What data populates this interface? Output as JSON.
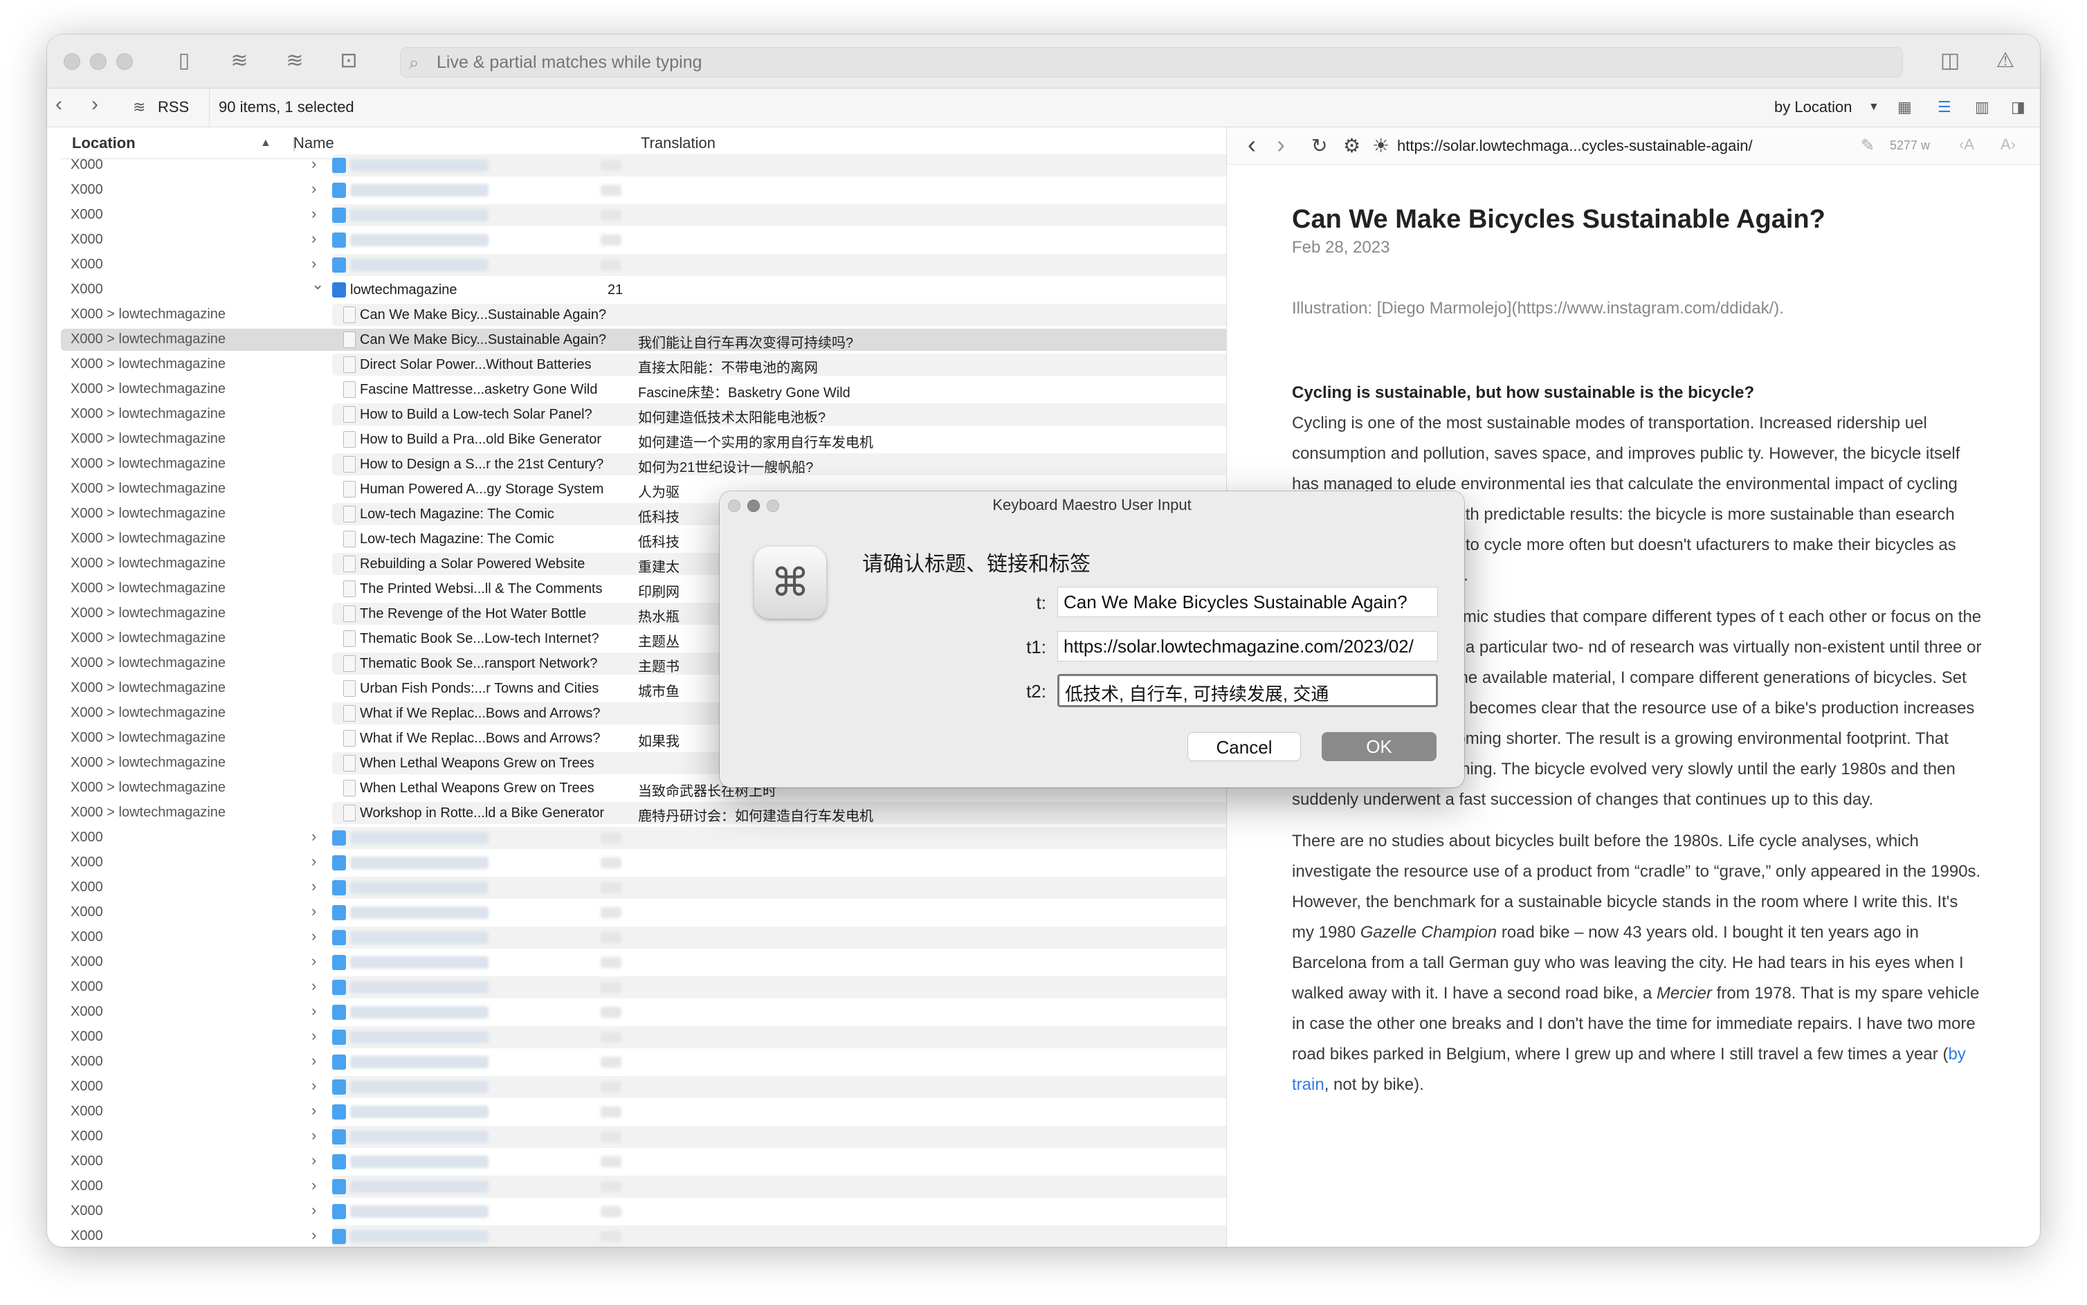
{
  "toolbar": {
    "search_placeholder": "Live & partial matches while typing"
  },
  "navbar": {
    "rss_label": "RSS",
    "status": "90 items, 1 selected",
    "sort_label": "by Location"
  },
  "table": {
    "headers": {
      "location": "Location",
      "name": "Name",
      "translation": "Translation"
    },
    "top_rows_location": "X000",
    "group": {
      "location": "X000",
      "name": "lowtechmagazine",
      "count": "21"
    },
    "child_location": "X000 > lowtechmagazine",
    "items": [
      {
        "name": "Can We Make Bicy...Sustainable Again?",
        "translation": ""
      },
      {
        "name": "Can We Make Bicy...Sustainable Again?",
        "translation": "我们能让自行车再次变得可持续吗?"
      },
      {
        "name": "Direct Solar Power...Without Batteries",
        "translation": "直接太阳能：不带电池的离网"
      },
      {
        "name": "Fascine Mattresse...asketry Gone Wild",
        "translation": "Fascine床垫：Basketry Gone Wild"
      },
      {
        "name": "How to Build a Low-tech Solar Panel?",
        "translation": "如何建造低技术太阳能电池板?"
      },
      {
        "name": "How to Build a Pra...old Bike Generator",
        "translation": "如何建造一个实用的家用自行车发电机"
      },
      {
        "name": "How to Design a S...r the 21st Century?",
        "translation": "如何为21世纪设计一艘帆船?"
      },
      {
        "name": "Human Powered A...gy Storage System",
        "translation": "人为驱"
      },
      {
        "name": "Low-tech Magazine: The Comic",
        "translation": "低科技"
      },
      {
        "name": "Low-tech Magazine: The Comic",
        "translation": "低科技"
      },
      {
        "name": "Rebuilding a Solar Powered Website",
        "translation": "重建太"
      },
      {
        "name": "The Printed Websi...ll & The Comments",
        "translation": "印刷网"
      },
      {
        "name": "The Revenge of the Hot Water Bottle",
        "translation": "热水瓶"
      },
      {
        "name": "Thematic Book Se...Low-tech Internet?",
        "translation": "主题丛"
      },
      {
        "name": "Thematic Book Se...ransport Network?",
        "translation": "主题书"
      },
      {
        "name": "Urban Fish Ponds:...r Towns and Cities",
        "translation": "城市鱼"
      },
      {
        "name": "What if We Replac...Bows and Arrows?",
        "translation": ""
      },
      {
        "name": "What if We Replac...Bows and Arrows?",
        "translation": "如果我"
      },
      {
        "name": "When Lethal Weapons Grew on Trees",
        "translation": ""
      },
      {
        "name": "When Lethal Weapons Grew on Trees",
        "translation": "当致命武器长在树上时"
      },
      {
        "name": "Workshop in Rotte...ld a Bike Generator",
        "translation": "鹿特丹研讨会：如何建造自行车发电机"
      }
    ],
    "bottom_rows_location": "X000"
  },
  "reader": {
    "url": "https://solar.lowtechmaga...cycles-sustainable-again/",
    "word_count": "5277 w",
    "title": "Can We Make Bicycles Sustainable Again?",
    "date": "Feb 28, 2023",
    "illustration": "Illustration: [Diego Marmolejo](https://www.instagram.com/ddidak/).",
    "subheading": "Cycling is sustainable, but how sustainable is the bicycle?",
    "p1": "Cycling is one of the most sustainable modes of transportation. Increased ridership uel consumption and pollution, saves space, and improves public ty. However, the bicycle itself has managed to elude environmental ies that calculate the environmental impact of cycling almost always riving, with predictable results: the bicycle is more sustainable than esearch may encourage people to cycle more often but doesn't ufacturers to make their bicycles as sustainable as possible.",
    "p2": "I have consulted academic studies that compare different types of t each other or focus on the manufacturing stage of a particular two- nd of research was virtually non-existent until three or four years ago. Using the available material, I compare different generations of bicycles. Set in a historical context, it becomes clear that the resource use of a bike's production increases while its lifetime is becoming shorter. The result is a growing environmental footprint. That trend has a clear beginning. The bicycle evolved very slowly until the early 1980s and then suddenly underwent a fast succession of changes that continues up to this day.",
    "p3a": "There are no studies about bicycles built before the 1980s. Life cycle analyses, which investigate the resource use of a product from “cradle” to “grave,” only appeared in the 1990s. However, the benchmark for a sustainable bicycle stands in the room where I write this. It's my 1980 ",
    "p3em1": "Gazelle Champion",
    "p3b": " road bike – now 43 years old. I bought it ten years ago in Barcelona from a tall German guy who was leaving the city. He had tears in his eyes when I walked away with it. I have a second road bike, a ",
    "p3em2": "Mercier",
    "p3c": " from 1978. That is my spare vehicle in case the other one breaks and I don't have the time for immediate repairs. I have two more road bikes parked in Belgium, where I grew up and where I still travel a few times a year (",
    "p3link": "by train",
    "p3d": ", not by bike)."
  },
  "dialog": {
    "title": "Keyboard Maestro User Input",
    "prompt": "请确认标题、链接和标签",
    "labels": {
      "t": "t:",
      "t1": "t1:",
      "t2": "t2:"
    },
    "values": {
      "t": "Can We Make Bicycles Sustainable Again?",
      "t1": "https://solar.lowtechmagazine.com/2023/02/",
      "t2": "低技术, 自行车, 可持续发展, 交通"
    },
    "cancel": "Cancel",
    "ok": "OK"
  },
  "colors": {
    "accent": "#2f7de1",
    "selected_row": "#dcdcdc",
    "ok_button": "#8a8a8a"
  }
}
